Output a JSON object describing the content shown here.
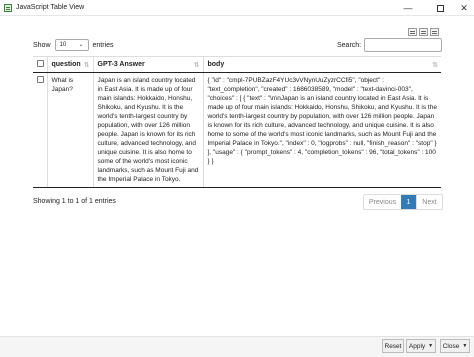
{
  "window": {
    "title": "JavaScript Table View",
    "minimize_glyph": "—",
    "close_glyph": "✕"
  },
  "controls": {
    "show_label": "Show",
    "page_length": "10",
    "entries_label": "entries",
    "search_label": "Search:",
    "search_value": ""
  },
  "table": {
    "columns": [
      "question",
      "GPT-3 Answer",
      "body"
    ],
    "rows": [
      {
        "question": "What is Japan?",
        "answer": "Japan is an island country located in East Asia. It is made up of four main islands: Hokkaido, Honshu, Shikoku, and Kyushu. It is the world's tenth-largest country by population, with over 126 million people. Japan is known for its rich culture, advanced technology, and unique cuisine. It is also home to some of the world's most iconic landmarks, such as Mount Fuji and the Imperial Palace in Tokyo.",
        "body": "{ \"id\" : \"cmpl-7PUBZazF4YUc3vVNynUuZyzrCCfi5\", \"object\" : \"text_completion\", \"created\" : 1686038589, \"model\" : \"text-davinci-003\", \"choices\" : [ { \"text\" : \"\\n\\nJapan is an island country located in East Asia. It is made up of four main islands: Hokkaido, Honshu, Shikoku, and Kyushu. It is the world's tenth-largest country by population, with over 126 million people. Japan is known for its rich culture, advanced technology, and unique cuisine. It is also home to some of the world's most iconic landmarks, such as Mount Fuji and the Imperial Palace in Tokyo.\", \"index\" : 0, \"logprobs\" : null, \"finish_reason\" : \"stop\" } ], \"usage\" : { \"prompt_tokens\" : 4, \"completion_tokens\" : 96, \"total_tokens\" : 100 } }"
      }
    ]
  },
  "footer": {
    "info": "Showing 1 to 1 of 1 entries",
    "previous": "Previous",
    "current_page": "1",
    "next": "Next"
  },
  "buttons": {
    "reset": "Reset",
    "apply": "Apply",
    "close": "Close",
    "caret": "▼"
  },
  "colors": {
    "accent": "#337ab7",
    "disabled_text": "#888888"
  }
}
